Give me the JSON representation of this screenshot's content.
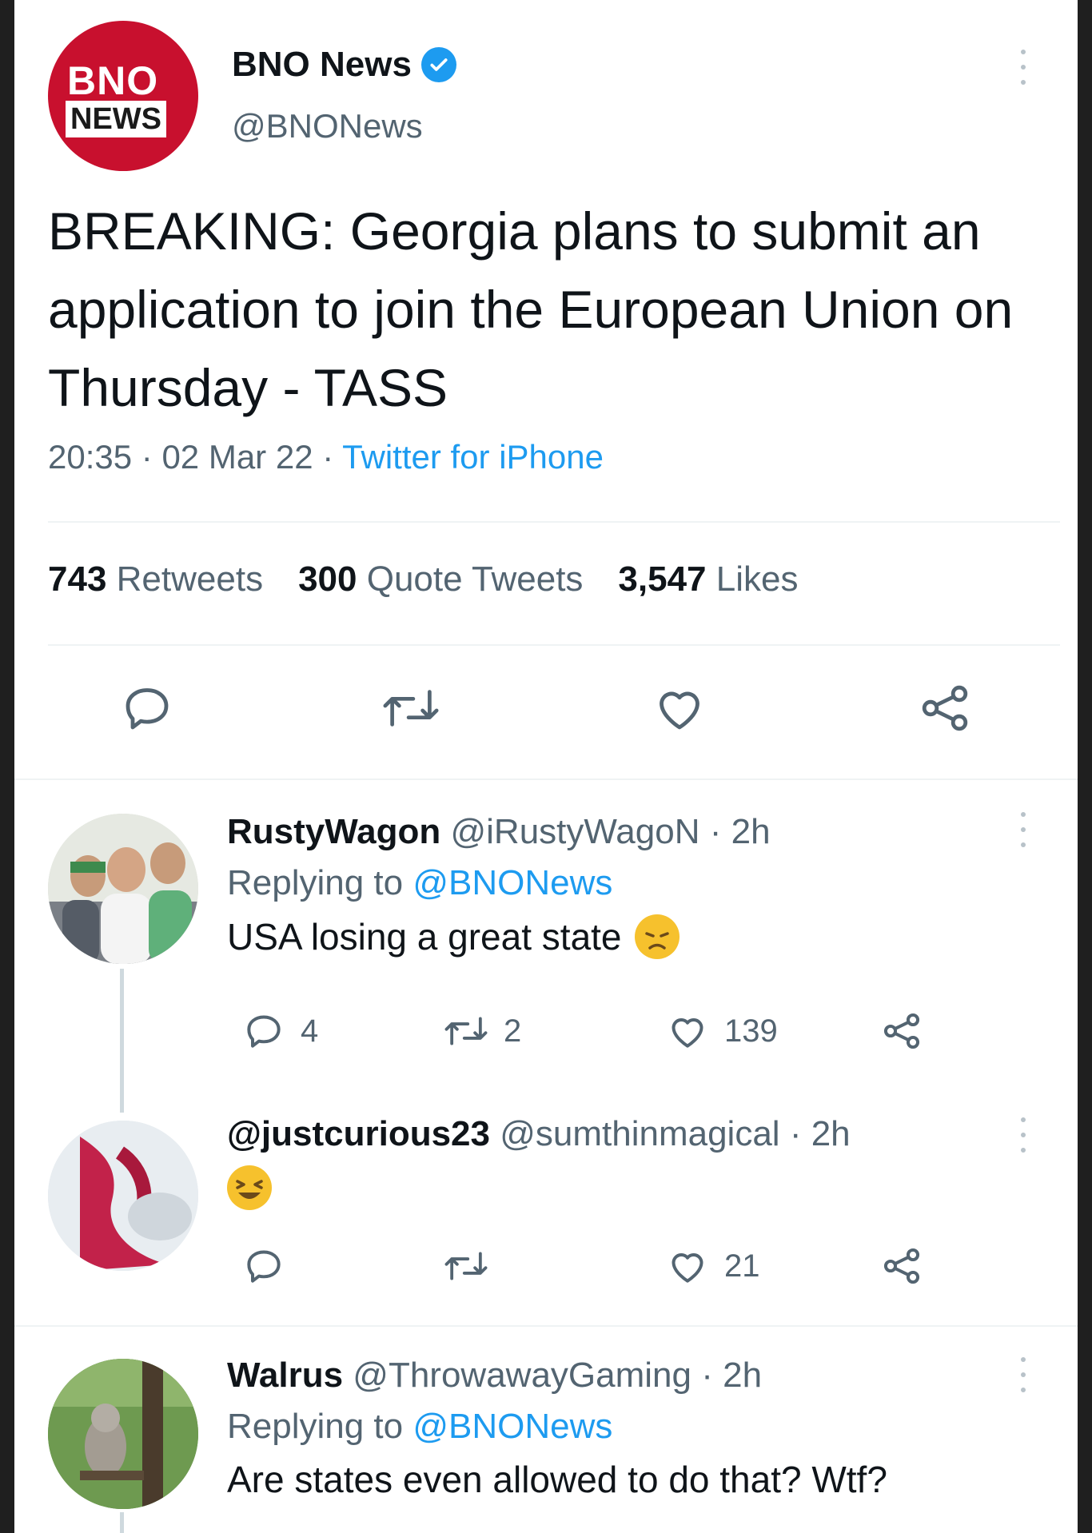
{
  "main_tweet": {
    "avatar_text_top": "BNO",
    "avatar_text_bottom": "NEWS",
    "display_name": "BNO News",
    "handle": "@BNONews",
    "text": "BREAKING: Georgia plans to submit an application to join the European Union on Thursday - TASS",
    "time": "20:35",
    "date": "02 Mar 22",
    "separator": "·",
    "source": "Twitter for iPhone",
    "retweets_count": "743",
    "retweets_label": "Retweets",
    "quotes_count": "300",
    "quotes_label": "Quote Tweets",
    "likes_count": "3,547",
    "likes_label": "Likes"
  },
  "replies": [
    {
      "name": "RustyWagon",
      "handle": "@iRustyWagoN",
      "time": "· 2h",
      "replying_prefix": "Replying to",
      "replying_to": "@BNONews",
      "text": "USA losing a great state",
      "emoji": "disappointed-face",
      "reply_count": "4",
      "retweet_count": "2",
      "like_count": "139"
    },
    {
      "name": "@justcurious23",
      "handle": "@sumthinmagical",
      "time": "· 2h",
      "emoji": "grinning-squinting-face",
      "like_count": "21"
    },
    {
      "name": "Walrus",
      "handle": "@ThrowawayGaming",
      "time": "· 2h",
      "replying_prefix": "Replying to",
      "replying_to": "@BNONews",
      "text": "Are states even allowed to do that? Wtf?"
    }
  ],
  "colors": {
    "brand_red": "#c8102e",
    "link_blue": "#1d9bf0",
    "muted_text": "#536471",
    "primary_text": "#0f1419"
  }
}
